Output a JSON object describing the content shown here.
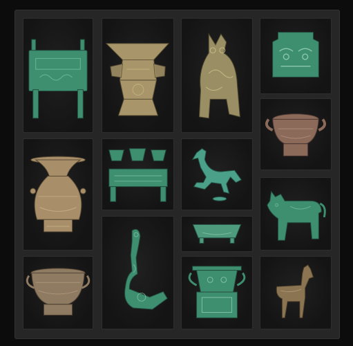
{
  "inventory": {
    "items": [
      {
        "name": "bronze-ding-cauldron-icon"
      },
      {
        "name": "bronze-zun-vessel-icon"
      },
      {
        "name": "bronze-owl-zun-icon"
      },
      {
        "name": "bronze-mask-plaque-icon"
      },
      {
        "name": "bronze-gui-bowl-icon"
      },
      {
        "name": "bronze-hu-vase-icon"
      },
      {
        "name": "bronze-triple-cup-stand-icon"
      },
      {
        "name": "bronze-galloping-horse-icon"
      },
      {
        "name": "bronze-ox-zun-icon"
      },
      {
        "name": "bronze-tray-icon"
      },
      {
        "name": "bronze-belt-hook-icon"
      },
      {
        "name": "bronze-fang-gui-icon"
      },
      {
        "name": "bronze-round-basin-icon"
      },
      {
        "name": "bronze-horse-statue-icon"
      }
    ]
  },
  "colors": {
    "patina_green": "#3e8f70",
    "bronze_gold": "#a8966a",
    "bronze_copper": "#8c6a5a",
    "slot_border": "#2e2e2e",
    "frame": "#262626"
  }
}
